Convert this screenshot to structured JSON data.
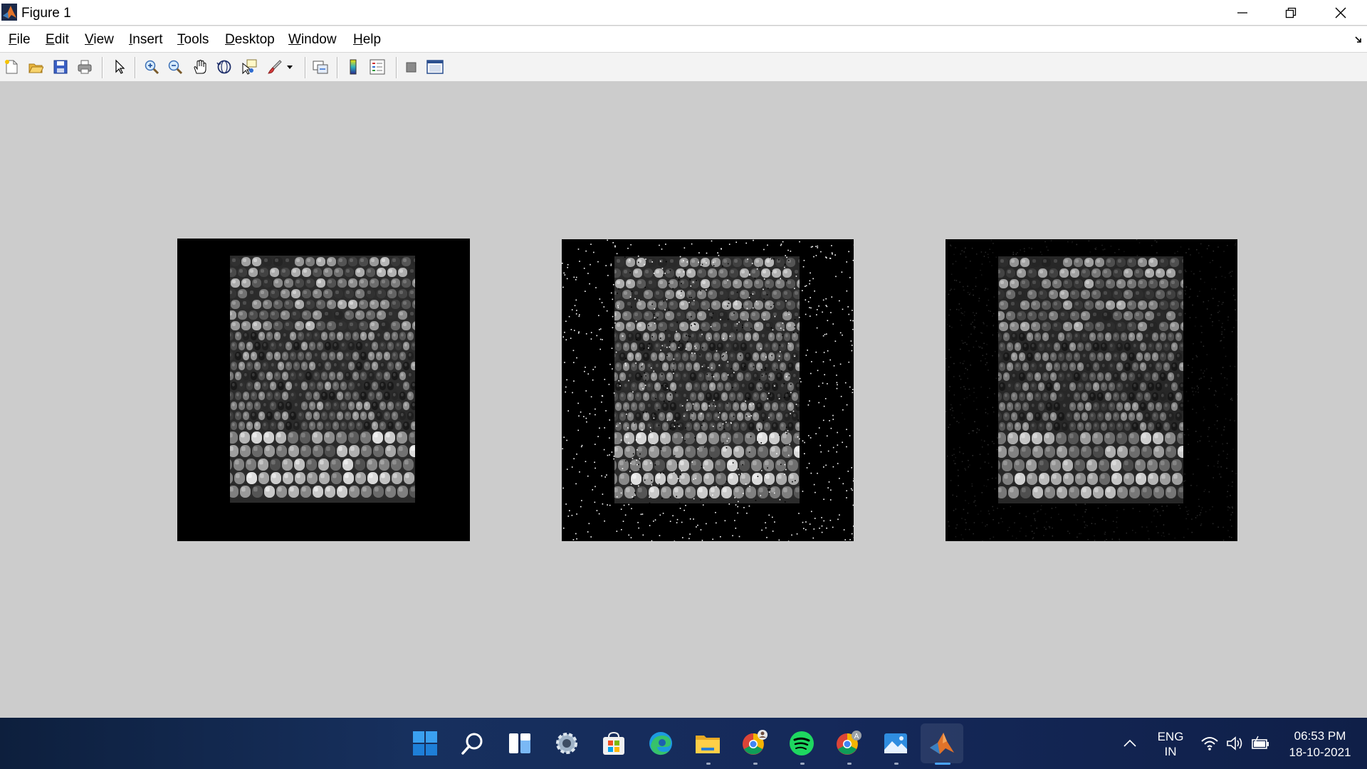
{
  "window": {
    "title": "Figure 1",
    "controls": [
      "minimize",
      "restore",
      "close"
    ]
  },
  "menubar": {
    "items": [
      {
        "accel": "F",
        "rest": "ile"
      },
      {
        "accel": "E",
        "rest": "dit"
      },
      {
        "accel": "V",
        "rest": "iew"
      },
      {
        "accel": "I",
        "rest": "nsert"
      },
      {
        "accel": "T",
        "rest": "ools"
      },
      {
        "accel": "D",
        "rest": "esktop"
      },
      {
        "accel": "W",
        "rest": "indow"
      },
      {
        "accel": "H",
        "rest": "elp"
      }
    ]
  },
  "toolbar": {
    "buttons": [
      "new-figure-icon",
      "open-file-icon",
      "save-figure-icon",
      "print-figure-icon",
      "edit-plot-arrow-icon",
      "zoom-in-icon",
      "zoom-out-icon",
      "pan-hand-icon",
      "rotate-3d-icon",
      "data-cursor-icon",
      "brush-icon",
      "brush-dropdown-icon",
      "link-plot-icon",
      "insert-colorbar-icon",
      "insert-legend-icon",
      "hide-plot-tools-icon",
      "show-plot-tools-icon"
    ]
  },
  "figure": {
    "background": "#cccccc",
    "panels": [
      {
        "name": "original-image",
        "noise": "none"
      },
      {
        "name": "noisy-image",
        "noise": "salt-and-pepper"
      },
      {
        "name": "filtered-image",
        "noise": "residual-speckle"
      }
    ]
  },
  "taskbar": {
    "apps": [
      "windows-start-icon",
      "search-icon",
      "task-view-icon",
      "settings-icon",
      "microsoft-store-icon",
      "edge-browser-icon",
      "file-explorer-icon",
      "chrome-profile-1-icon",
      "spotify-icon",
      "chrome-profile-2-icon",
      "photos-icon",
      "matlab-icon"
    ],
    "active_app": "matlab-icon"
  },
  "tray": {
    "lang_line1": "ENG",
    "lang_line2": "IN",
    "time": "06:53 PM",
    "date": "18-10-2021"
  },
  "colors": {
    "accent_blue": "#2f7de1",
    "taskbar_bg": "#142a56",
    "matlab_orange": "#e1732a"
  }
}
